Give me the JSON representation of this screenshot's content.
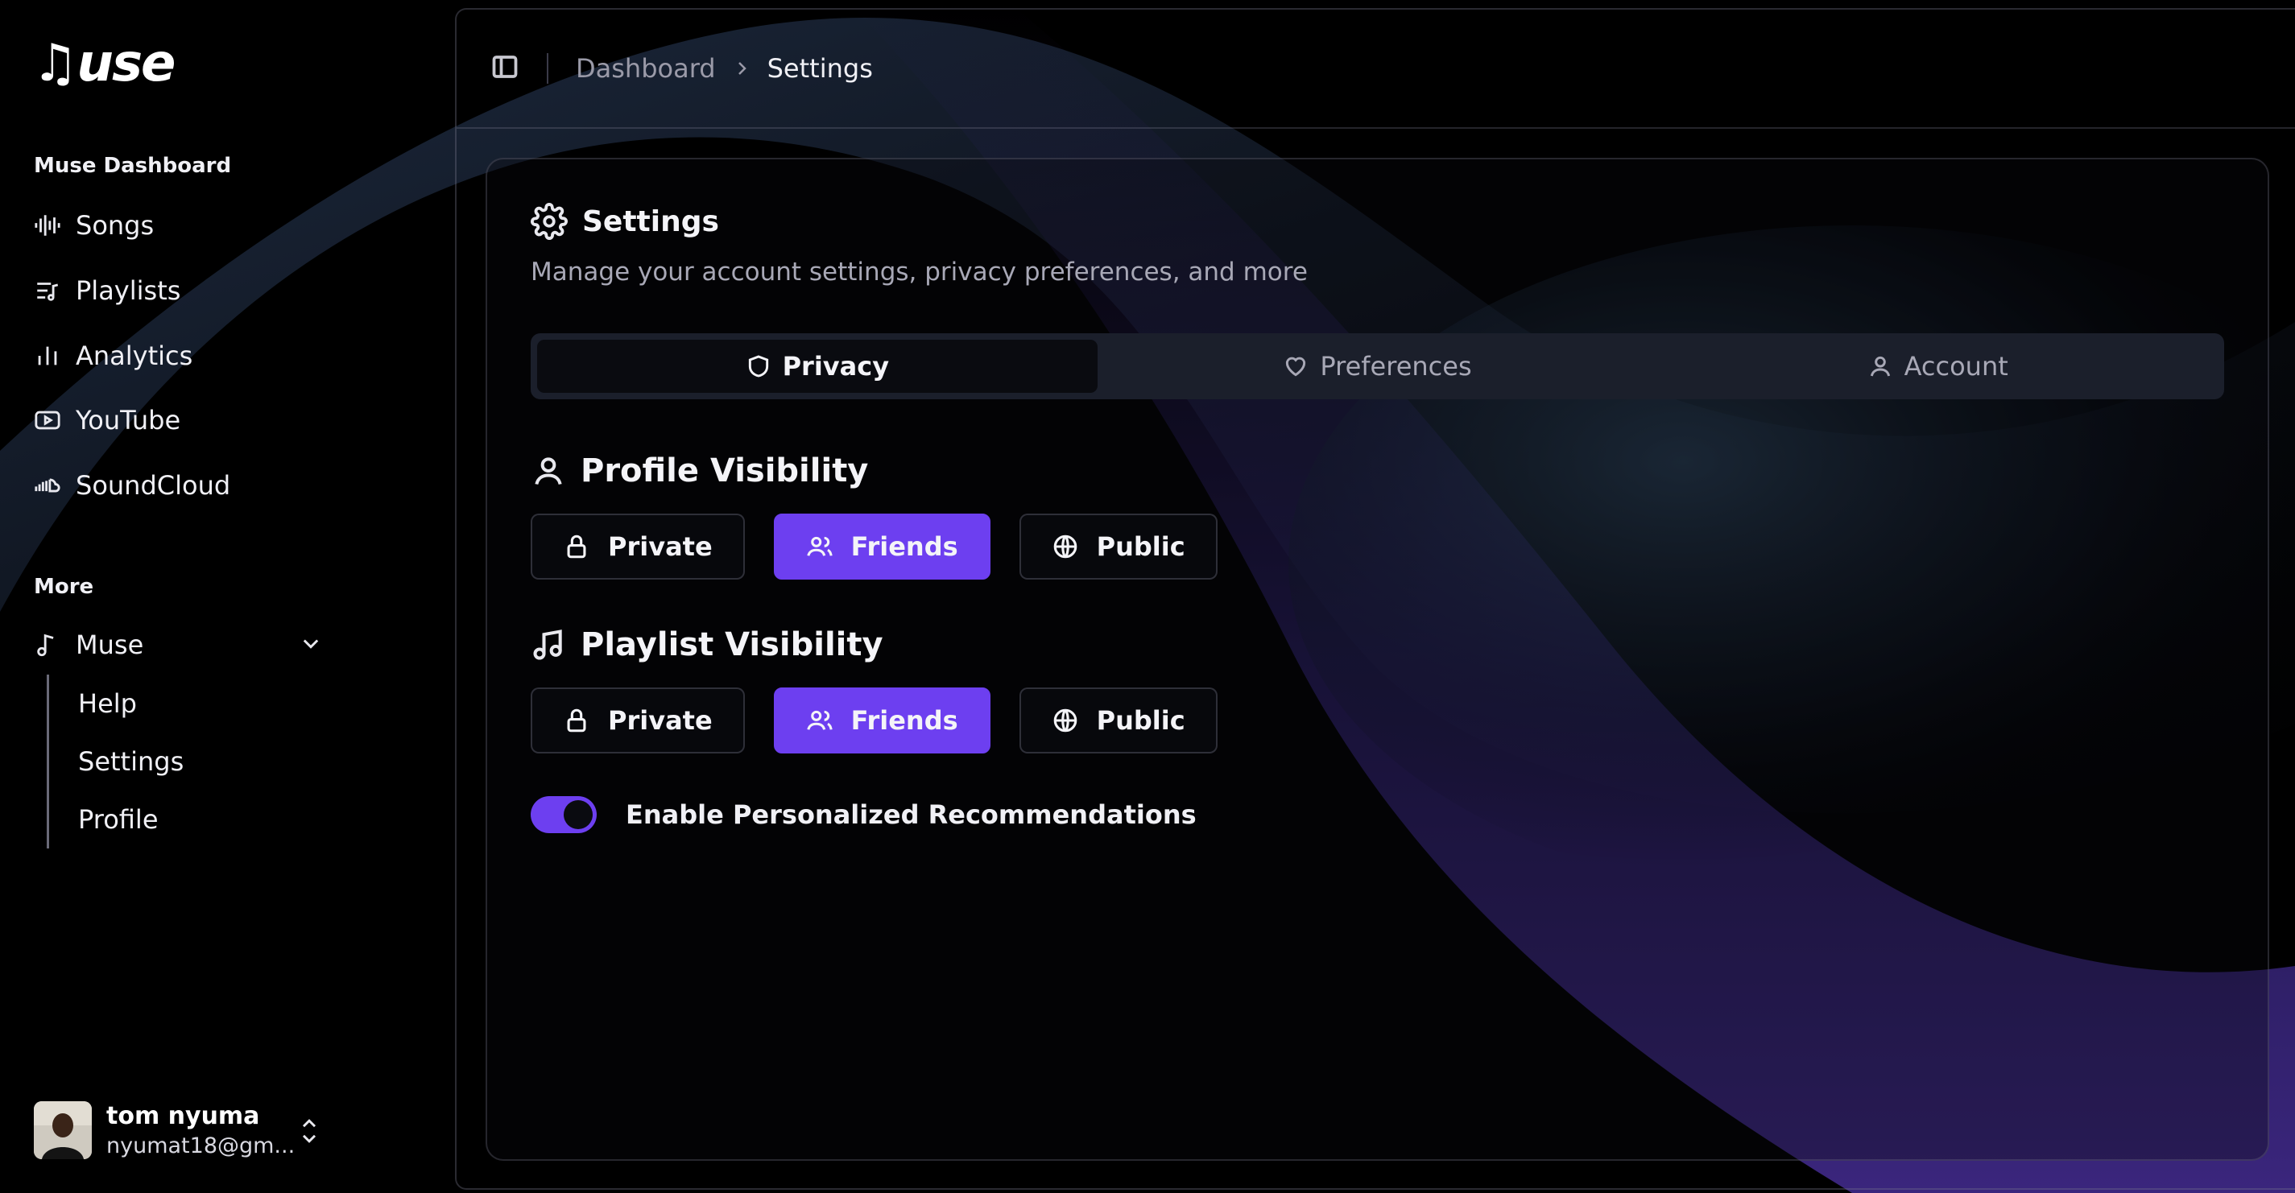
{
  "app": {
    "logo_text": "♫use"
  },
  "sidebar": {
    "group_label": "Muse Dashboard",
    "items": [
      {
        "label": "Songs",
        "icon": "audio-waveform-icon"
      },
      {
        "label": "Playlists",
        "icon": "list-music-icon"
      },
      {
        "label": "Analytics",
        "icon": "bar-chart-icon"
      },
      {
        "label": "YouTube",
        "icon": "youtube-icon"
      },
      {
        "label": "SoundCloud",
        "icon": "soundcloud-icon"
      }
    ],
    "more_label": "More",
    "more_item": {
      "label": "Muse",
      "icon": "music-note-icon"
    },
    "sub_items": [
      {
        "label": "Help"
      },
      {
        "label": "Settings"
      },
      {
        "label": "Profile"
      }
    ],
    "user": {
      "name": "tom nyuma",
      "email": "nyumat18@gm..."
    }
  },
  "topbar": {
    "breadcrumb": [
      "Dashboard",
      "Settings"
    ]
  },
  "card": {
    "title": "Settings",
    "description": "Manage your account settings, privacy preferences, and more",
    "tabs": [
      {
        "label": "Privacy",
        "icon": "shield-icon",
        "active": true
      },
      {
        "label": "Preferences",
        "icon": "heart-icon",
        "active": false
      },
      {
        "label": "Account",
        "icon": "user-icon",
        "active": false
      }
    ],
    "profile_visibility": {
      "title": "Profile Visibility",
      "options": [
        "Private",
        "Friends",
        "Public"
      ],
      "selected": "Friends"
    },
    "playlist_visibility": {
      "title": "Playlist Visibility",
      "options": [
        "Private",
        "Friends",
        "Public"
      ],
      "selected": "Friends"
    },
    "recommendations": {
      "label": "Enable Personalized Recommendations",
      "enabled": true
    }
  },
  "colors": {
    "accent": "#6d3ff0",
    "background": "#000000",
    "tab_bar": "#1b1f2b"
  }
}
